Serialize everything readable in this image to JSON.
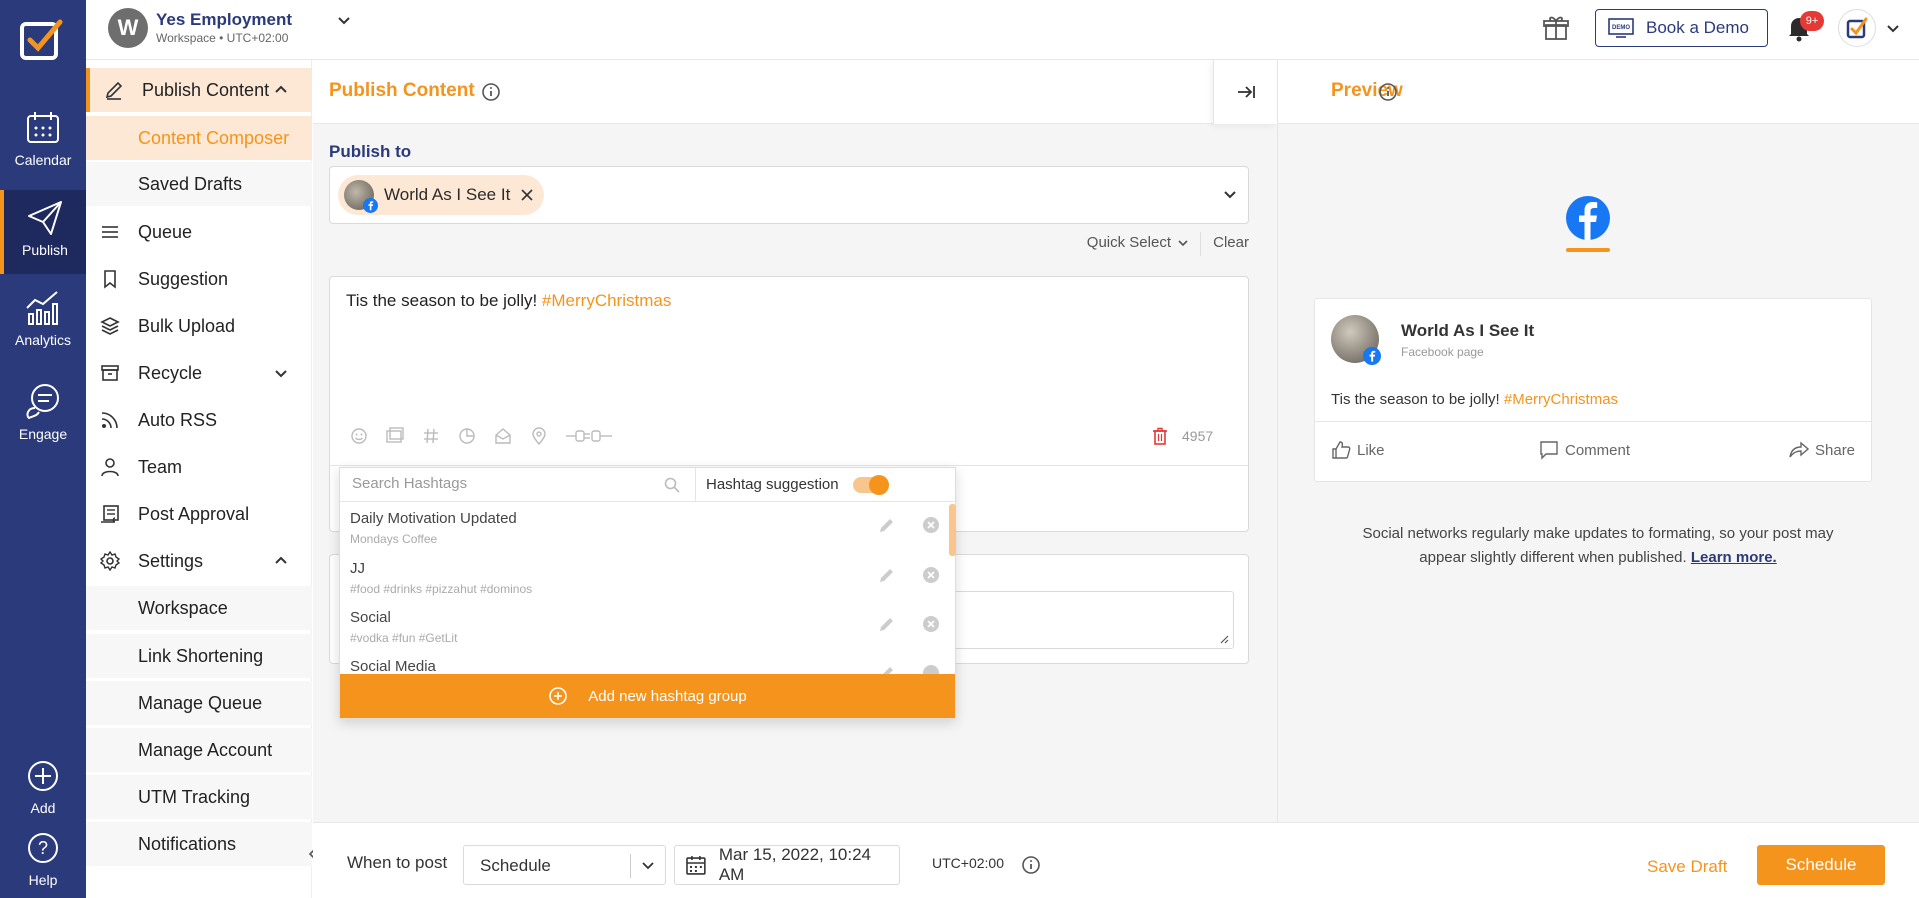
{
  "rail": {
    "items": [
      {
        "label": "Calendar"
      },
      {
        "label": "Publish"
      },
      {
        "label": "Analytics"
      },
      {
        "label": "Engage"
      }
    ],
    "bottom": [
      {
        "label": "Add"
      },
      {
        "label": "Help"
      }
    ]
  },
  "topbar": {
    "workspace_initial": "W",
    "workspace_name": "Yes Employment",
    "workspace_sub": "Workspace • UTC+02:00",
    "book_demo": "Book a Demo",
    "notifications_badge": "9+"
  },
  "sidebar": {
    "publish_content": "Publish Content",
    "content_composer": "Content Composer",
    "saved_drafts": "Saved Drafts",
    "queue": "Queue",
    "suggestion": "Suggestion",
    "bulk_upload": "Bulk Upload",
    "recycle": "Recycle",
    "auto_rss": "Auto RSS",
    "team": "Team",
    "post_approval": "Post Approval",
    "settings": "Settings",
    "workspace": "Workspace",
    "link_shortening": "Link Shortening",
    "manage_queue": "Manage Queue",
    "manage_account": "Manage Account",
    "utm_tracking": "UTM Tracking",
    "notifications": "Notifications"
  },
  "composer": {
    "title": "Publish Content",
    "publish_to_label": "Publish to",
    "account_chip": "World As I See It",
    "quick_select": "Quick Select",
    "clear": "Clear",
    "text_plain": "Tis the season to be jolly! ",
    "text_hashtag": "#MerryChristmas",
    "char_count": "4957"
  },
  "hashtags": {
    "search_placeholder": "Search Hashtags",
    "suggestion_label": "Hashtag suggestion",
    "suggestion_on": true,
    "groups": [
      {
        "name": "Daily Motivation Updated",
        "tags": "Mondays Coffee"
      },
      {
        "name": "JJ",
        "tags": "#food #drinks #pizzahut #dominos"
      },
      {
        "name": "Social",
        "tags": "#vodka #fun #GetLit"
      },
      {
        "name": "Social Media",
        "tags": ""
      }
    ],
    "add_button": "Add new hashtag group"
  },
  "preview": {
    "title": "Preview",
    "page_name": "World As I See It",
    "page_type": "Facebook page",
    "text_plain": "Tis the season to be jolly! ",
    "text_hashtag": "#MerryChristmas",
    "like": "Like",
    "comment": "Comment",
    "share": "Share",
    "note": "Social networks regularly make updates to formating, so your post may appear slightly different when published.",
    "learn_more": "Learn more."
  },
  "bottom": {
    "when_label": "When to post",
    "schedule_mode": "Schedule",
    "datetime": "Mar 15, 2022, 10:24 AM",
    "timezone": "UTC+02:00",
    "save_draft": "Save Draft",
    "schedule_button": "Schedule"
  },
  "colors": {
    "brand_navy": "#2b3a7a",
    "accent_orange": "#f5941d",
    "facebook_blue": "#1877f2",
    "alert_red": "#e53935"
  }
}
